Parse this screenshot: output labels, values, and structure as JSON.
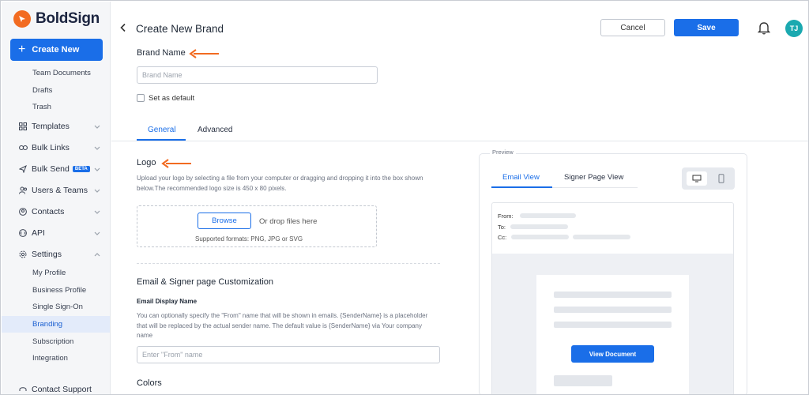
{
  "app": {
    "name": "BoldSign"
  },
  "sidebar": {
    "create_label": "Create New",
    "documents_subitems": [
      "Team Documents",
      "Drafts",
      "Trash"
    ],
    "nav": [
      {
        "label": "Templates",
        "icon": "grid-icon"
      },
      {
        "label": "Bulk Links",
        "icon": "link-icon"
      },
      {
        "label": "Bulk Send",
        "icon": "send-icon",
        "badge": "BETA"
      },
      {
        "label": "Users & Teams",
        "icon": "users-icon"
      },
      {
        "label": "Contacts",
        "icon": "contact-icon"
      },
      {
        "label": "API",
        "icon": "api-icon"
      },
      {
        "label": "Settings",
        "icon": "gear-icon"
      }
    ],
    "settings_subitems": [
      "My Profile",
      "Business Profile",
      "Single Sign-On",
      "Branding",
      "Subscription",
      "Integration"
    ],
    "active_item": "Branding",
    "footer_label": "Contact Support"
  },
  "header": {
    "title": "Create New Brand",
    "cancel_label": "Cancel",
    "save_label": "Save",
    "avatar_initials": "TJ"
  },
  "form": {
    "brand_name_label": "Brand Name",
    "brand_name_placeholder": "Brand Name",
    "default_checkbox_label": "Set as default",
    "tabs": [
      "General",
      "Advanced"
    ],
    "active_tab": "General",
    "logo": {
      "heading": "Logo",
      "description": "Upload your logo by selecting a file from your computer or dragging and dropping it into the box shown below.The recommended logo size is 450 x 80 pixels.",
      "browse_label": "Browse",
      "drop_text": "Or drop files here",
      "formats_text": "Supported formats: PNG, JPG or SVG"
    },
    "email_section": {
      "heading": "Email & Signer page Customization",
      "display_name_label": "Email Display Name",
      "display_name_description": "You can optionally specify the \"From\" name that will be shown in emails. {SenderName} is a placeholder that will be replaced by the actual sender name. The default value is {SenderName} via Your company name",
      "display_name_placeholder": "Enter \"From\" name"
    },
    "colors_heading": "Colors"
  },
  "preview": {
    "legend": "Preview",
    "tabs": [
      "Email View",
      "Signer Page View"
    ],
    "active_tab": "Email View",
    "mail_labels": {
      "from": "From:",
      "to": "To:",
      "cc": "Cc:"
    },
    "view_document_label": "View Document"
  },
  "colors": {
    "accent": "#1a6ee8",
    "brand_orange": "#f26b21",
    "avatar": "#1ba9b0",
    "annotation_arrow": "#f26b21"
  }
}
